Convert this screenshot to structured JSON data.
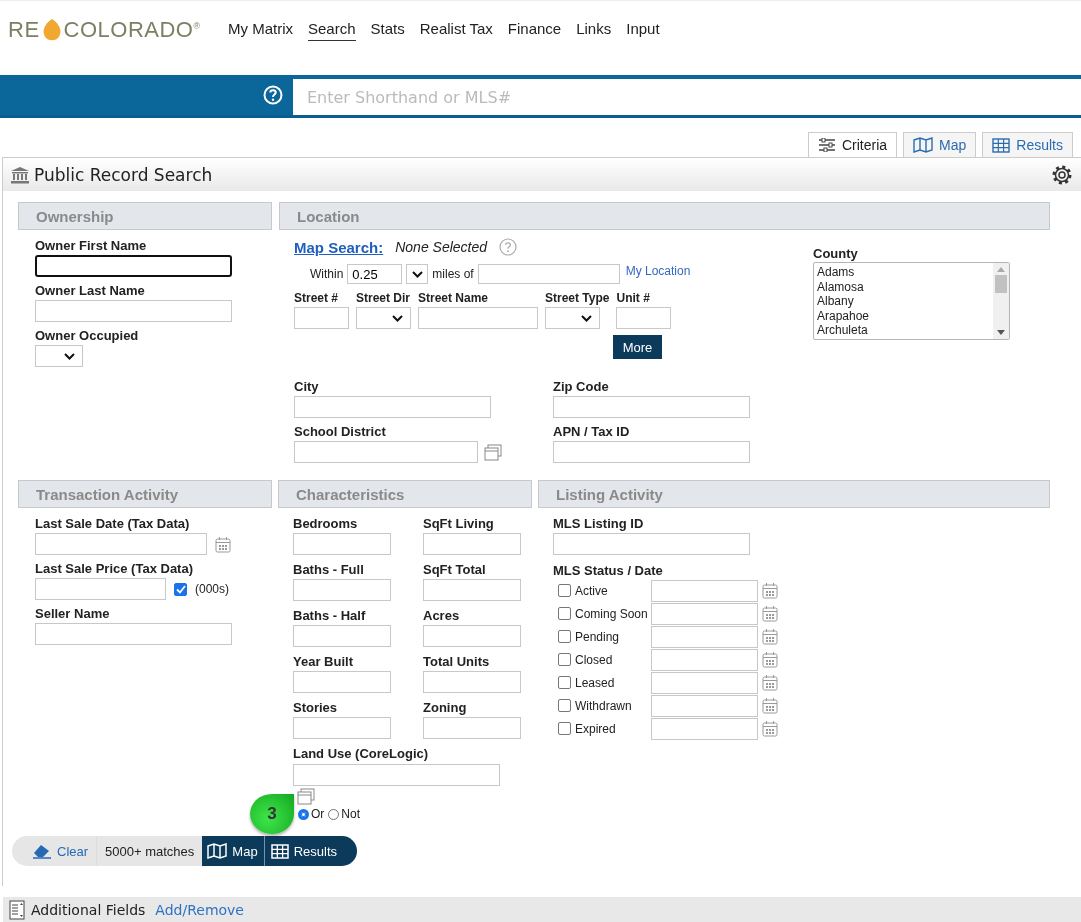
{
  "logo": {
    "left": "RE",
    "right": "COLORADO",
    "registered": "®"
  },
  "nav": [
    {
      "label": "My Matrix",
      "selected": false
    },
    {
      "label": "Search",
      "selected": true
    },
    {
      "label": "Stats",
      "selected": false
    },
    {
      "label": "Realist Tax",
      "selected": false
    },
    {
      "label": "Finance",
      "selected": false
    },
    {
      "label": "Links",
      "selected": false
    },
    {
      "label": "Input",
      "selected": false
    }
  ],
  "quick_search": {
    "placeholder": "Enter Shorthand or MLS#"
  },
  "view_tabs": [
    {
      "label": "Criteria",
      "kind": "criteria",
      "selected": true
    },
    {
      "label": "Map",
      "kind": "map",
      "selected": false
    },
    {
      "label": "Results",
      "kind": "results",
      "selected": false
    }
  ],
  "panel_title": "Public Record Search",
  "ownership": {
    "title": "Ownership",
    "fields": [
      {
        "label": "Owner First Name",
        "kind": "text",
        "focused": true
      },
      {
        "label": "Owner Last Name",
        "kind": "text",
        "focused": false
      },
      {
        "label": "Owner Occupied",
        "kind": "select",
        "focused": false
      }
    ]
  },
  "location": {
    "title": "Location",
    "map_search": "Map Search:",
    "map_status": "None Selected",
    "within_label": "Within",
    "within_value": "0.25",
    "miles_label": "miles of",
    "my_location": "My Location",
    "street_fields": [
      {
        "label": "Street #",
        "kind": "text"
      },
      {
        "label": "Street Dir",
        "kind": "select"
      },
      {
        "label": "Street Name",
        "kind": "wide"
      },
      {
        "label": "Street Type",
        "kind": "select"
      },
      {
        "label": "Unit #",
        "kind": "text"
      }
    ],
    "more_button": "More",
    "fields": [
      {
        "label": "City",
        "picker": false
      },
      {
        "label": "Zip Code",
        "picker": false
      },
      {
        "label": "School District",
        "picker": true
      },
      {
        "label": "APN / Tax ID",
        "picker": false
      }
    ],
    "county": {
      "label": "County",
      "options": [
        "Adams",
        "Alamosa",
        "Albany",
        "Arapahoe",
        "Archuleta"
      ]
    }
  },
  "transaction": {
    "title": "Transaction Activity",
    "fields": [
      {
        "label": "Last Sale Date (Tax Data)",
        "kind": "date"
      },
      {
        "label": "Last Sale Price (Tax Data)",
        "kind": "price",
        "unit": "(000s)",
        "checked": true
      },
      {
        "label": "Seller Name",
        "kind": "text"
      }
    ]
  },
  "characteristics": {
    "title": "Characteristics",
    "fields": [
      "Bedrooms",
      "SqFt Living",
      "Baths - Full",
      "SqFt Total",
      "Baths - Half",
      "Acres",
      "Year Built",
      "Total Units",
      "Stories",
      "Zoning"
    ],
    "land_use": "Land Use (CoreLogic)",
    "match_options": [
      {
        "label": "Or",
        "selected": true
      },
      {
        "label": "Not",
        "selected": false
      }
    ]
  },
  "listing": {
    "title": "Listing Activity",
    "listing_id_label": "MLS Listing ID",
    "status_label": "MLS Status / Date",
    "statuses": [
      {
        "label": "Active",
        "checked": false
      },
      {
        "label": "Coming Soon",
        "checked": false
      },
      {
        "label": "Pending",
        "checked": false
      },
      {
        "label": "Closed",
        "checked": false
      },
      {
        "label": "Leased",
        "checked": false
      },
      {
        "label": "Withdrawn",
        "checked": false
      },
      {
        "label": "Expired",
        "checked": false
      }
    ]
  },
  "step_badge": "3",
  "action_bar": {
    "clear": "Clear",
    "matches": "5000+ matches",
    "map": "Map",
    "results": "Results"
  },
  "additional_fields": {
    "label": "Additional Fields",
    "link": "Add/Remove"
  }
}
